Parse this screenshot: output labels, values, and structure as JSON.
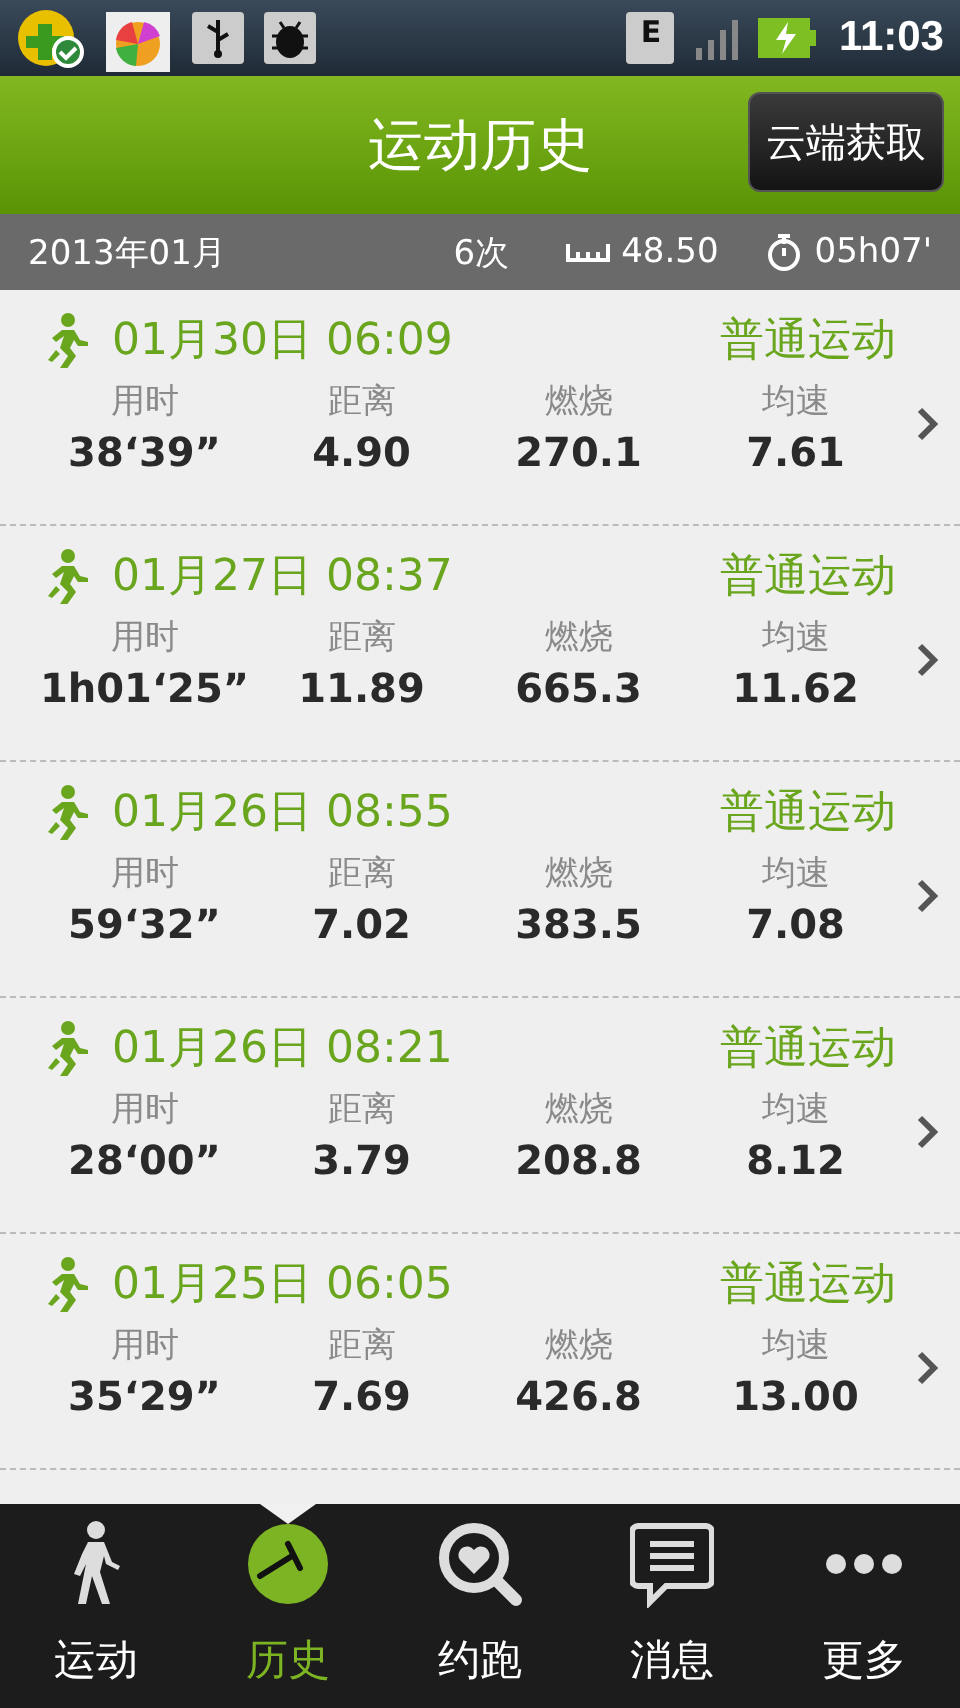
{
  "status_bar": {
    "network": "E",
    "time": "11:03"
  },
  "header": {
    "title": "运动历史",
    "action": "云端获取"
  },
  "summary": {
    "month": "2013年01月",
    "count": "6次",
    "distance": "48.50",
    "duration": "05h07'"
  },
  "records": [
    {
      "datetime": "01月30日 06:09",
      "type": "普通运动",
      "stats": [
        {
          "label": "用时",
          "value": "38‘39”"
        },
        {
          "label": "距离",
          "value": "4.90"
        },
        {
          "label": "燃烧",
          "value": "270.1"
        },
        {
          "label": "均速",
          "value": "7.61"
        }
      ]
    },
    {
      "datetime": "01月27日 08:37",
      "type": "普通运动",
      "stats": [
        {
          "label": "用时",
          "value": "1h01‘25”"
        },
        {
          "label": "距离",
          "value": "11.89"
        },
        {
          "label": "燃烧",
          "value": "665.3"
        },
        {
          "label": "均速",
          "value": "11.62"
        }
      ]
    },
    {
      "datetime": "01月26日 08:55",
      "type": "普通运动",
      "stats": [
        {
          "label": "用时",
          "value": "59‘32”"
        },
        {
          "label": "距离",
          "value": "7.02"
        },
        {
          "label": "燃烧",
          "value": "383.5"
        },
        {
          "label": "均速",
          "value": "7.08"
        }
      ]
    },
    {
      "datetime": "01月26日 08:21",
      "type": "普通运动",
      "stats": [
        {
          "label": "用时",
          "value": "28‘00”"
        },
        {
          "label": "距离",
          "value": "3.79"
        },
        {
          "label": "燃烧",
          "value": "208.8"
        },
        {
          "label": "均速",
          "value": "8.12"
        }
      ]
    },
    {
      "datetime": "01月25日 06:05",
      "type": "普通运动",
      "stats": [
        {
          "label": "用时",
          "value": "35‘29”"
        },
        {
          "label": "距离",
          "value": "7.69"
        },
        {
          "label": "燃烧",
          "value": "426.8"
        },
        {
          "label": "均速",
          "value": "13.00"
        }
      ]
    }
  ],
  "tabs": [
    {
      "kind": "walk",
      "label": "运动",
      "selected": false
    },
    {
      "kind": "history",
      "label": "历史",
      "selected": true
    },
    {
      "kind": "date",
      "label": "约跑",
      "selected": false
    },
    {
      "kind": "message",
      "label": "消息",
      "selected": false
    },
    {
      "kind": "more",
      "label": "更多",
      "selected": false
    }
  ]
}
